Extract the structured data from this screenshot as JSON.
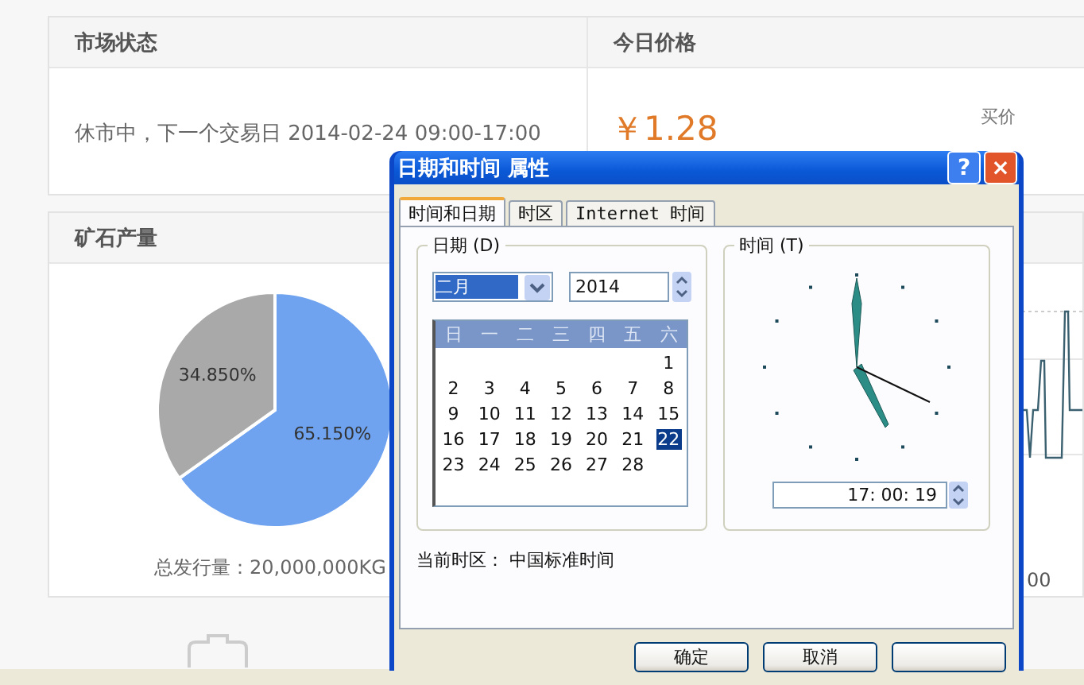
{
  "market_card": {
    "status_header": "市场状态",
    "status_text": "休市中，下一个交易日 2014-02-24 09:00-17:00",
    "price_header": "今日价格",
    "price": "￥1.28",
    "bid_label": "买价"
  },
  "ore_card": {
    "title": "矿石产量",
    "chart_data": {
      "type": "pie",
      "values": [
        65.15,
        34.85
      ],
      "value_labels": [
        "65.150%",
        "34.850%"
      ]
    },
    "total": "总发行量：20,000,000KG"
  },
  "right_card": {
    "column_1": "00"
  },
  "dialog": {
    "title": "日期和时间 属性",
    "help": "?",
    "close": "×",
    "tabs": [
      {
        "label": "时间和日期",
        "selected": true
      },
      {
        "label": "时区",
        "selected": false
      },
      {
        "label": "Internet 时间",
        "selected": false
      }
    ],
    "date_group": {
      "legend": "日期 (D)",
      "month": "二月",
      "year": "2014",
      "weekdays": [
        "日",
        "一",
        "二",
        "三",
        "四",
        "五",
        "六"
      ],
      "weeks": [
        {
          "days": [
            {
              "kind": "blank"
            },
            {
              "kind": "blank"
            },
            {
              "kind": "blank"
            },
            {
              "kind": "blank"
            },
            {
              "kind": "blank"
            },
            {
              "kind": "blank"
            },
            {
              "kind": "day",
              "day": "1",
              "selected": false
            }
          ]
        },
        {
          "days": [
            {
              "kind": "day",
              "day": "2",
              "selected": false
            },
            {
              "kind": "day",
              "day": "3",
              "selected": false
            },
            {
              "kind": "day",
              "day": "4",
              "selected": false
            },
            {
              "kind": "day",
              "day": "5",
              "selected": false
            },
            {
              "kind": "day",
              "day": "6",
              "selected": false
            },
            {
              "kind": "day",
              "day": "7",
              "selected": false
            },
            {
              "kind": "day",
              "day": "8",
              "selected": false
            }
          ]
        },
        {
          "days": [
            {
              "kind": "day",
              "day": "9",
              "selected": false
            },
            {
              "kind": "day",
              "day": "10",
              "selected": false
            },
            {
              "kind": "day",
              "day": "11",
              "selected": false
            },
            {
              "kind": "day",
              "day": "12",
              "selected": false
            },
            {
              "kind": "day",
              "day": "13",
              "selected": false
            },
            {
              "kind": "day",
              "day": "14",
              "selected": false
            },
            {
              "kind": "day",
              "day": "15",
              "selected": false
            }
          ]
        },
        {
          "days": [
            {
              "kind": "day",
              "day": "16",
              "selected": false
            },
            {
              "kind": "day",
              "day": "17",
              "selected": false
            },
            {
              "kind": "day",
              "day": "18",
              "selected": false
            },
            {
              "kind": "day",
              "day": "19",
              "selected": false
            },
            {
              "kind": "day",
              "day": "20",
              "selected": false
            },
            {
              "kind": "day",
              "day": "21",
              "selected": false
            },
            {
              "kind": "day",
              "day": "22",
              "selected": true
            }
          ]
        },
        {
          "days": [
            {
              "kind": "day",
              "day": "23",
              "selected": false
            },
            {
              "kind": "day",
              "day": "24",
              "selected": false
            },
            {
              "kind": "day",
              "day": "25",
              "selected": false
            },
            {
              "kind": "day",
              "day": "26",
              "selected": false
            },
            {
              "kind": "day",
              "day": "27",
              "selected": false
            },
            {
              "kind": "day",
              "day": "28",
              "selected": false
            }
          ]
        }
      ]
    },
    "time_group": {
      "legend": "时间 (T)",
      "time": "17: 00: 19"
    },
    "timezone": "当前时区：  中国标准时间",
    "buttons": [
      "确定",
      "取消"
    ]
  }
}
